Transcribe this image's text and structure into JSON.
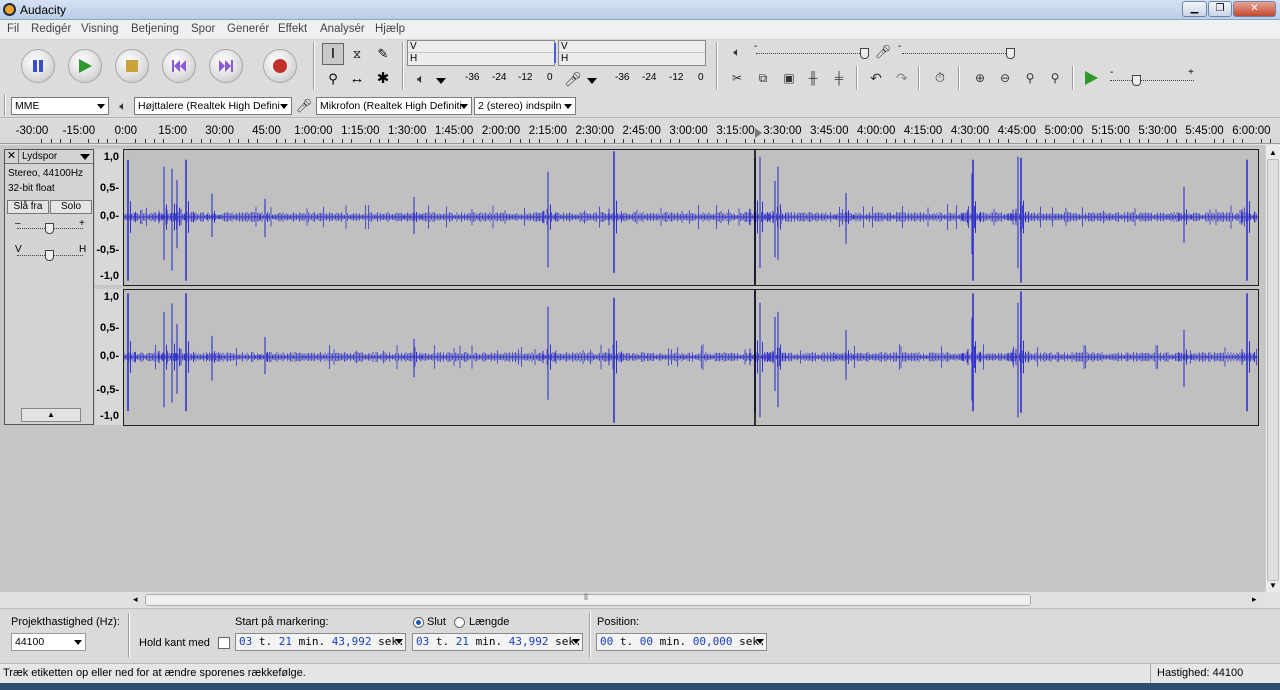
{
  "window": {
    "title": "Audacity"
  },
  "menu": [
    "Fil",
    "Redigér",
    "Visning",
    "Betjening",
    "Spor",
    "Generér",
    "Effekt",
    "Analysér",
    "Hjælp"
  ],
  "meters": {
    "play_channels": [
      "V",
      "H"
    ],
    "rec_channels": [
      "V",
      "H"
    ],
    "scale": [
      "-36",
      "-24",
      "-12",
      "0"
    ]
  },
  "mixer": {
    "minus": "-",
    "plus": "+"
  },
  "speed": {
    "minus": "-",
    "plus": "+"
  },
  "devices": {
    "host": "MME",
    "output": "Højttalere (Realtek High Defini",
    "input": "Mikrofon (Realtek High Definiti",
    "channels": "2 (stereo) indspiln"
  },
  "ruler": {
    "ticks": [
      "-30:00",
      "-15:00",
      "0:00",
      "15:00",
      "30:00",
      "45:00",
      "1:00:00",
      "1:15:00",
      "1:30:00",
      "1:45:00",
      "2:00:00",
      "2:15:00",
      "2:30:00",
      "2:45:00",
      "3:00:00",
      "3:15:00",
      "3:30:00",
      "3:45:00",
      "4:00:00",
      "4:15:00",
      "4:30:00",
      "4:45:00",
      "5:00:00",
      "5:15:00",
      "5:30:00",
      "5:45:00",
      "6:00:00"
    ]
  },
  "track": {
    "close": "✕",
    "name": "Lydspor",
    "info_format": "Stereo, 44100Hz",
    "info_bits": "32-bit float",
    "mute": "Slå fra",
    "solo": "Solo",
    "gain_minus": "–",
    "gain_plus": "+",
    "pan_left": "V",
    "pan_right": "H",
    "collapse": "▲",
    "scale": [
      "1,0",
      "0,5-",
      "0,0-",
      "-0,5-",
      "-1,0"
    ]
  },
  "selection": {
    "rate_label": "Projekthastighed (Hz):",
    "rate_value": "44100",
    "snap_label": "Hold kant med",
    "start_label": "Start på markering:",
    "end_radio": "Slut",
    "length_radio": "Længde",
    "start_value": {
      "h": "03",
      "h_unit": "t.",
      "m": "21",
      "m_unit": "min.",
      "s": "43,992",
      "s_unit": "sek."
    },
    "end_value": {
      "h": "03",
      "h_unit": "t.",
      "m": "21",
      "m_unit": "min.",
      "s": "43,992",
      "s_unit": "sek."
    },
    "position_label": "Position:",
    "position_value": {
      "h": "00",
      "h_unit": "t.",
      "m": "00",
      "m_unit": "min.",
      "s": "00,000",
      "s_unit": "sek."
    }
  },
  "status": {
    "message": "Træk etiketten op eller ned for at ændre sporenes rækkefølge.",
    "rate": "Hastighed: 44100"
  },
  "colors": {
    "waveform": "#3232c8",
    "record": "#c2302c",
    "play": "#2e9a2e"
  }
}
